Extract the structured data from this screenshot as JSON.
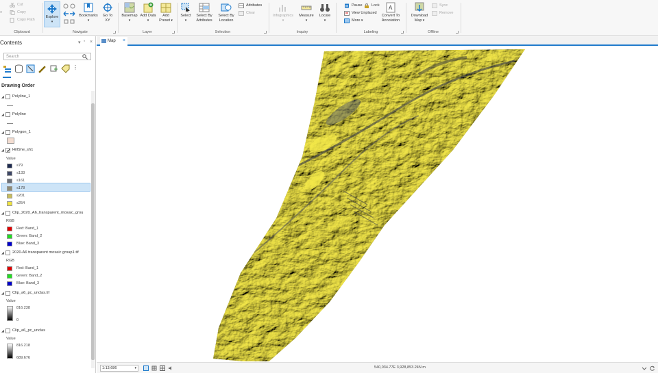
{
  "ribbon": {
    "clipboard": {
      "cut": "Cut",
      "copy": "Copy",
      "copy_path": "Copy Path",
      "label": "Clipboard"
    },
    "navigate": {
      "explore": "Explore",
      "bookmarks": "Bookmarks",
      "go_to_xy": "Go To XY",
      "label": "Navigate"
    },
    "layer": {
      "basemap": "Basemap",
      "add_data": "Add Data",
      "add_preset": "Add Preset",
      "label": "Layer"
    },
    "selection": {
      "select": "Select",
      "by_attributes": "Select By Attributes",
      "by_location": "Select By Location",
      "attributes": "Attributes",
      "clear": "Clear",
      "label": "Selection"
    },
    "inquiry": {
      "infographics": "Infographics",
      "measure": "Measure",
      "locate": "Locate",
      "label": "Inquiry"
    },
    "labeling": {
      "pause": "Pause",
      "lock": "Lock",
      "view_unplaced": "View Unplaced",
      "more": "More",
      "convert": "Convert To Annotation",
      "label": "Labeling"
    },
    "offline": {
      "download": "Download Map",
      "sync": "Sync",
      "remove": "Remove",
      "label": "Offline"
    }
  },
  "contents": {
    "title": "Contents",
    "search_placeholder": "Search",
    "drawing_order": "Drawing Order",
    "layers": {
      "polyline1": "Polyline_1",
      "polyline": "Polyline",
      "polygon1": "Polygon_1",
      "hillshade": {
        "name": "HillShe_sh1",
        "value_label": "Value",
        "classes": [
          "≤79",
          "≤133",
          "≤161",
          "≤178",
          "≤201",
          "≤254"
        ]
      },
      "clip2020": {
        "name": "Clip_2020_A6_transparent_mosaic_grou",
        "rgb": "RGB",
        "bands": [
          "Red: Band_1",
          "Green: Band_2",
          "Blue: Band_3"
        ]
      },
      "mosaic": {
        "name": "2020-A6 transparent mosaic group1.tif",
        "rgb": "RGB",
        "bands": [
          "Red: Band_1",
          "Green: Band_2",
          "Blue: Band_3"
        ]
      },
      "cliptif": {
        "name": "Clip_a6_pc_unclas.tif",
        "value_label": "Value",
        "high": "816.238",
        "low": "0"
      },
      "clipunclas": {
        "name": "Clip_a6_pc_unclas",
        "value_label": "Value",
        "high": "816.218",
        "low": "689.676"
      }
    }
  },
  "tabs": {
    "map": "Map"
  },
  "status": {
    "scale": "1:13,686",
    "coords": "540,034.77E 3,928,853.24N m"
  },
  "colors": {
    "accent": "#1f7acb",
    "hillshade": [
      "#1d2a4f",
      "#3e4868",
      "#6b7079",
      "#8f8c76",
      "#c8bd5c",
      "#f0e440"
    ],
    "rgb": [
      "#e00000",
      "#22dd22",
      "#0000cc"
    ]
  }
}
